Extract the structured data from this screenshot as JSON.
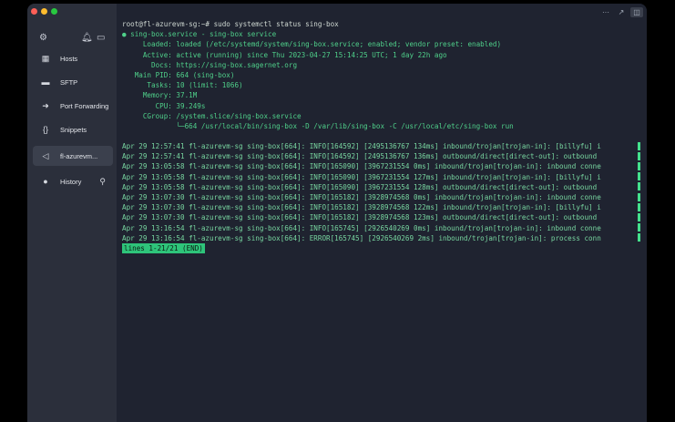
{
  "sidebar": {
    "nav": [
      {
        "label": "Hosts",
        "icon": "grid-icon"
      },
      {
        "label": "SFTP",
        "icon": "folder-icon"
      },
      {
        "label": "Port Forwarding",
        "icon": "arrow-right-icon"
      },
      {
        "label": "Snippets",
        "icon": "braces-icon"
      },
      {
        "label": "fl-azurevm...",
        "icon": "terminal-tab-icon"
      },
      {
        "label": "History",
        "icon": "history-icon"
      }
    ]
  },
  "terminal": {
    "prompt_line": "root@fl-azurevm-sg:~# sudo systemctl status sing-box",
    "service_header": "● sing-box.service - sing-box service",
    "status_lines": [
      "     Loaded: loaded (/etc/systemd/system/sing-box.service; enabled; vendor preset: enabled)",
      "     Active: active (running) since Thu 2023-04-27 15:14:25 UTC; 1 day 22h ago",
      "       Docs: https://sing-box.sagernet.org",
      "   Main PID: 664 (sing-box)",
      "      Tasks: 10 (limit: 1066)",
      "     Memory: 37.1M",
      "        CPU: 39.249s",
      "     CGroup: /system.slice/sing-box.service",
      "             └─664 /usr/local/bin/sing-box -D /var/lib/sing-box -C /usr/local/etc/sing-box run"
    ],
    "log_lines": [
      "Apr 29 12:57:41 fl-azurevm-sg sing-box[664]: INFO[164592] [2495136767 134ms] inbound/trojan[trojan-in]: [billyfu] i",
      "Apr 29 12:57:41 fl-azurevm-sg sing-box[664]: INFO[164592] [2495136767 136ms] outbound/direct[direct-out]: outbound",
      "Apr 29 13:05:58 fl-azurevm-sg sing-box[664]: INFO[165090] [3967231554 0ms] inbound/trojan[trojan-in]: inbound conne",
      "Apr 29 13:05:58 fl-azurevm-sg sing-box[664]: INFO[165090] [3967231554 127ms] inbound/trojan[trojan-in]: [billyfu] i",
      "Apr 29 13:05:58 fl-azurevm-sg sing-box[664]: INFO[165090] [3967231554 128ms] outbound/direct[direct-out]: outbound",
      "Apr 29 13:07:30 fl-azurevm-sg sing-box[664]: INFO[165182] [3928974568 0ms] inbound/trojan[trojan-in]: inbound conne",
      "Apr 29 13:07:30 fl-azurevm-sg sing-box[664]: INFO[165182] [3928974568 122ms] inbound/trojan[trojan-in]: [billyfu] i",
      "Apr 29 13:07:30 fl-azurevm-sg sing-box[664]: INFO[165182] [3928974568 123ms] outbound/direct[direct-out]: outbound",
      "Apr 29 13:16:54 fl-azurevm-sg sing-box[664]: INFO[165745] [2926540269 0ms] inbound/trojan[trojan-in]: inbound conne",
      "Apr 29 13:16:54 fl-azurevm-sg sing-box[664]: ERROR[165745] [2926540269 2ms] inbound/trojan[trojan-in]: process conn"
    ],
    "pager_status": "lines 1-21/21 (END)"
  }
}
